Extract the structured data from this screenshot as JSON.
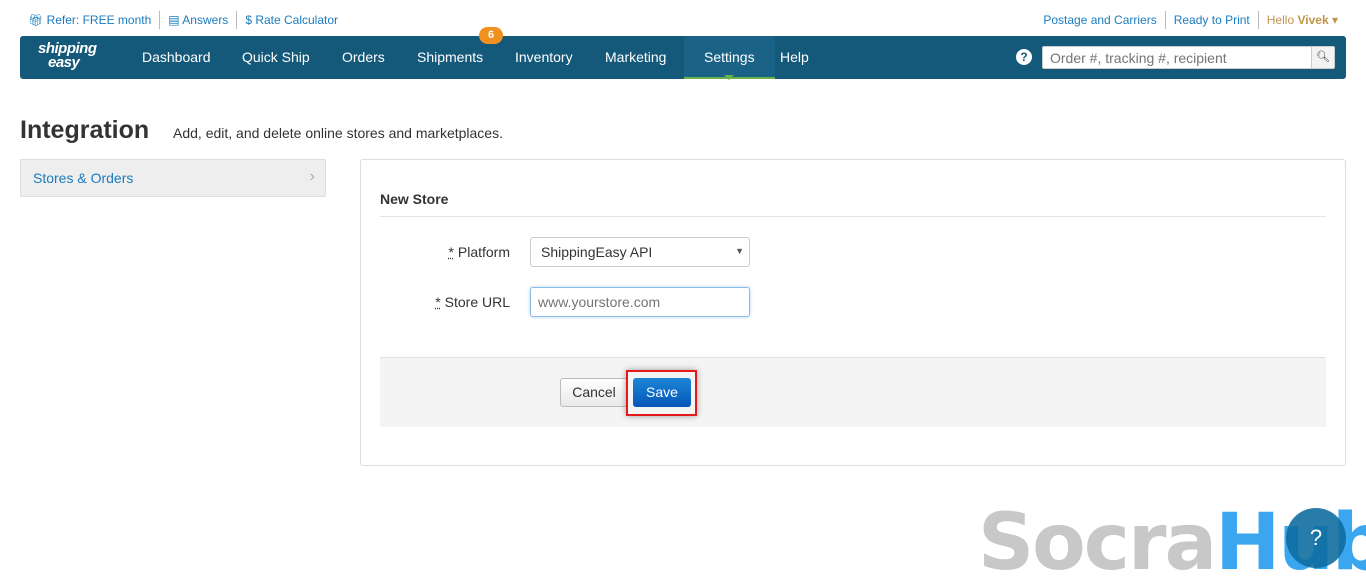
{
  "top_links": {
    "refer": "Refer: FREE month",
    "answers": "Answers",
    "rate": "$ Rate Calculator",
    "postage": "Postage and Carriers",
    "ready": "Ready to Print",
    "hello": "Hello",
    "user": "Vivek"
  },
  "nav": {
    "logo_top": "shipping",
    "logo_bottom": "easy",
    "items": [
      "Dashboard",
      "Quick Ship",
      "Orders",
      "Shipments",
      "Inventory",
      "Marketing",
      "Settings",
      "Help"
    ],
    "active": "Settings",
    "shipments_badge": "6",
    "search_placeholder": "Order #, tracking #, recipient",
    "help": "?"
  },
  "page": {
    "title": "Integration",
    "subtitle": "Add, edit, and delete online stores and marketplaces."
  },
  "sidebar": {
    "item": "Stores & Orders"
  },
  "form": {
    "title": "New Store",
    "platform_label": "Platform",
    "platform_value": "ShippingEasy API",
    "url_label": "Store URL",
    "url_placeholder": "www.yourstore.com",
    "required": "*",
    "cancel": "Cancel",
    "save": "Save"
  },
  "watermark": {
    "a": "Socra",
    "b": "Hub"
  },
  "colors": {
    "nav": "#14587a",
    "link": "#1a7bbf",
    "primary": "#0a66c2",
    "badge": "#f0901e"
  }
}
